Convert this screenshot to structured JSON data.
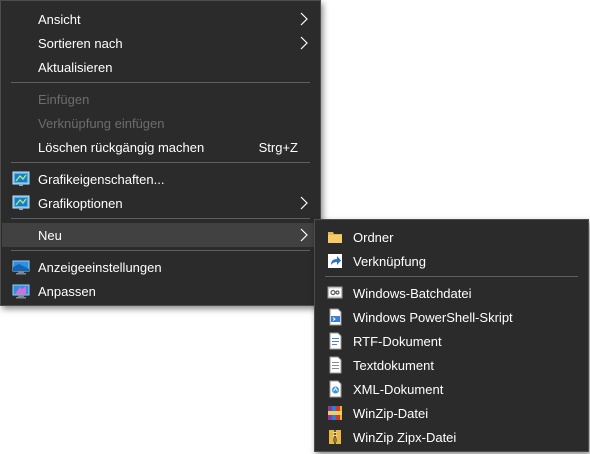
{
  "context_menu": {
    "items": [
      {
        "label": "Ansicht"
      },
      {
        "label": "Sortieren nach"
      },
      {
        "label": "Aktualisieren"
      },
      {
        "label": "Einfügen"
      },
      {
        "label": "Verknüpfung einfügen"
      },
      {
        "label": "Löschen rückgängig machen",
        "shortcut": "Strg+Z"
      },
      {
        "label": "Grafikeigenschaften..."
      },
      {
        "label": "Grafikoptionen"
      },
      {
        "label": "Neu"
      },
      {
        "label": "Anzeigeeinstellungen"
      },
      {
        "label": "Anpassen"
      }
    ]
  },
  "new_submenu": {
    "items": [
      {
        "label": "Ordner",
        "icon": "folder-icon"
      },
      {
        "label": "Verknüpfung",
        "icon": "shortcut-icon"
      },
      {
        "label": "Windows-Batchdatei",
        "icon": "batch-file-icon"
      },
      {
        "label": "Windows PowerShell-Skript",
        "icon": "powershell-script-icon"
      },
      {
        "label": "RTF-Dokument",
        "icon": "rtf-document-icon"
      },
      {
        "label": "Textdokument",
        "icon": "text-document-icon"
      },
      {
        "label": "XML-Dokument",
        "icon": "xml-document-icon"
      },
      {
        "label": "WinZip-Datei",
        "icon": "winzip-icon"
      },
      {
        "label": "WinZip Zipx-Datei",
        "icon": "winzip-zipx-icon"
      }
    ]
  },
  "colors": {
    "menu_background": "#2b2b2b",
    "menu_text": "#ffffff",
    "disabled_text": "#6d6d6d",
    "highlight": "#414141",
    "separator": "#5f5f5f"
  }
}
